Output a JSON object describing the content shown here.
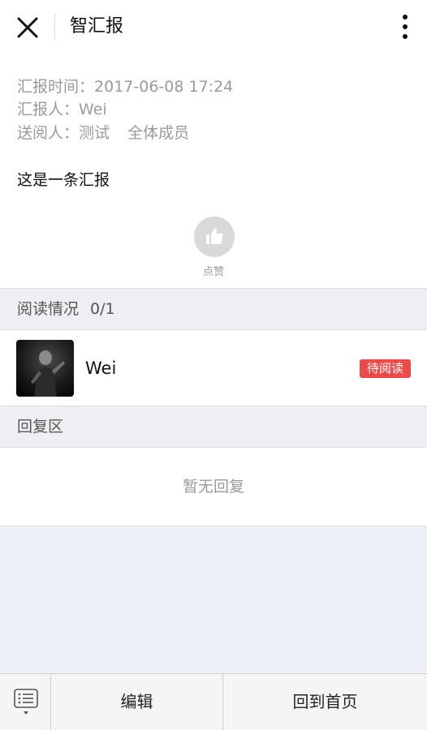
{
  "header": {
    "title": "智汇报",
    "close_icon": "close-icon",
    "more_icon": "more-vertical-icon"
  },
  "report": {
    "time_label": "汇报时间：",
    "time_value": "2017-06-08 17:24",
    "reporter_label": "汇报人：",
    "reporter_value": "Wei",
    "recipients_label": "送阅人：",
    "recipients": [
      "测试",
      "全体成员"
    ],
    "body": "这是一条汇报",
    "like_icon": "thumbs-up-icon",
    "like_label": "点赞"
  },
  "reading": {
    "title": "阅读情况",
    "count": "0/1",
    "readers": [
      {
        "name": "Wei",
        "status": "待阅读",
        "status_color": "#ea4a4a"
      }
    ]
  },
  "replies": {
    "title": "回复区",
    "empty_text": "暂无回复"
  },
  "bottom": {
    "menu_icon": "list-menu-icon",
    "edit_label": "编辑",
    "home_label": "回到首页"
  },
  "colors": {
    "accent_badge": "#ea4a4a",
    "muted_text": "#9a9a9a",
    "page_bg": "#edf0f6"
  }
}
